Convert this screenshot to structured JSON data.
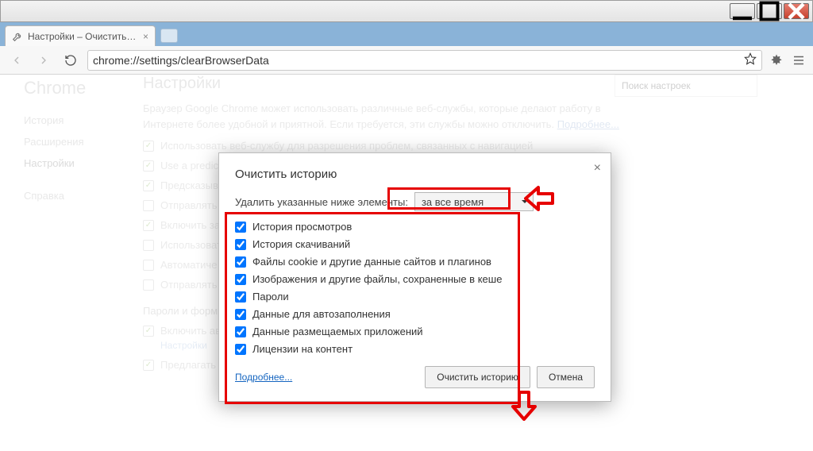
{
  "window": {
    "tab_title": "Настройки – Очистить ис",
    "url": "chrome://settings/clearBrowserData"
  },
  "sidebar": {
    "brand": "Chrome",
    "items": [
      "История",
      "Расширения",
      "Настройки"
    ],
    "help": "Справка"
  },
  "page": {
    "title": "Настройки",
    "search_placeholder": "Поиск настроек",
    "description_1": "Браузер Google Chrome может использовать различные веб-службы, которые делают работу в Интернете более удобной и приятной. Если требуется, эти службы можно отключить.",
    "learn_more": "Подробнее...",
    "options": [
      "Использовать веб-службу для разрешения проблем, связанных с навигацией",
      "Use a predict",
      "Предсказыва",
      "Отправлять",
      "Включить за",
      "Использоват",
      "Автоматиче",
      "Отправлять"
    ],
    "forms_head": "Пароли и формы",
    "forms_opts": [
      "Включить ав",
      "Предлагать"
    ],
    "settings_sub": "Настройки"
  },
  "dialog": {
    "title": "Очистить историю",
    "prompt": "Удалить указанные ниже элементы:",
    "dropdown_value": "за все время",
    "checks": [
      "История просмотров",
      "История скачиваний",
      "Файлы cookie и другие данные сайтов и плагинов",
      "Изображения и другие файлы, сохраненные в кеше",
      "Пароли",
      "Данные для автозаполнения",
      "Данные размещаемых приложений",
      "Лицензии на контент"
    ],
    "learn_more": "Подробнее...",
    "btn_primary": "Очистить историю",
    "btn_cancel": "Отмена"
  }
}
